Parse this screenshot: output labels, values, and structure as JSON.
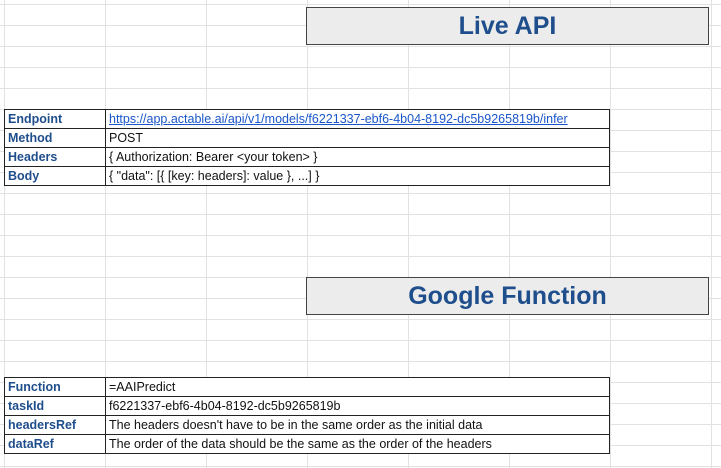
{
  "live_api": {
    "title": "Live API",
    "rows": [
      {
        "key": "Endpoint",
        "value": "https://app.actable.ai/api/v1/models/f6221337-ebf6-4b04-8192-dc5b9265819b/infer"
      },
      {
        "key": "Method",
        "value": "POST"
      },
      {
        "key": "Headers",
        "value": "{ Authorization: Bearer <your token> }"
      },
      {
        "key": "Body",
        "value": "{ \"data\": [{ [key: headers]: value }, ...] }"
      }
    ]
  },
  "google_function": {
    "title": "Google Function",
    "rows": [
      {
        "key": "Function",
        "value": "=AAIPredict"
      },
      {
        "key": "taskId",
        "value": "f6221337-ebf6-4b04-8192-dc5b9265819b"
      },
      {
        "key": "headersRef",
        "value": "The headers doesn't have to be in the same order as the initial data"
      },
      {
        "key": "dataRef",
        "value": "The order of the data should be the same as the order of the headers"
      }
    ]
  },
  "colors": {
    "header_text": "#1f4e8c",
    "header_bg": "#ececec",
    "link": "#1a56c9",
    "gridline": "#e2e2e2"
  }
}
